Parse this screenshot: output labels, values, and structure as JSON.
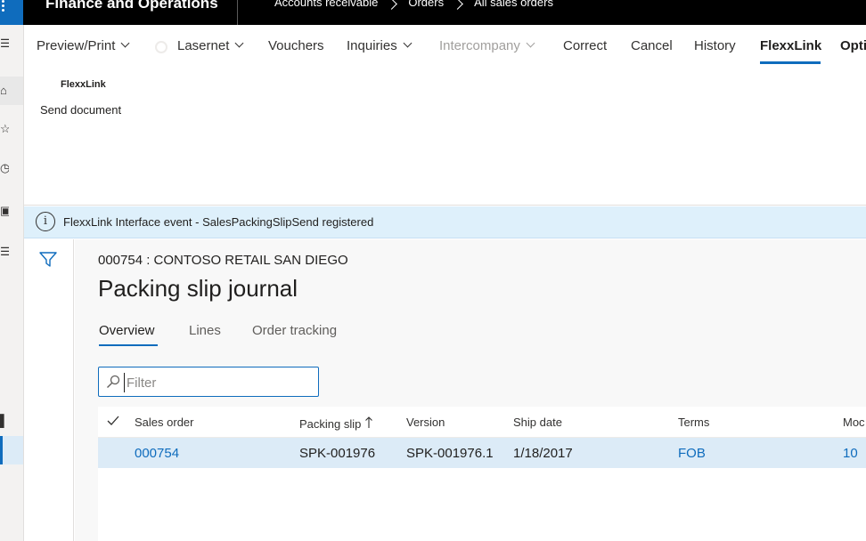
{
  "topbar": {
    "app_title": "Finance and Operations",
    "breadcrumb": [
      "Accounts receivable",
      "Orders",
      "All sales orders"
    ]
  },
  "actions": {
    "preview_print": "Preview/Print",
    "lasernet": "Lasernet",
    "vouchers": "Vouchers",
    "inquiries": "Inquiries",
    "intercompany": "Intercompany",
    "correct": "Correct",
    "cancel": "Cancel",
    "history": "History",
    "flexxlink": "FlexxLink",
    "options": "Opti"
  },
  "ribbon": {
    "group_label": "FlexxLink",
    "send_document": "Send document"
  },
  "info_bar": {
    "message": "FlexxLink Interface event - SalesPackingSlipSend registered"
  },
  "page": {
    "record_title": "000754 : CONTOSO RETAIL SAN DIEGO",
    "title": "Packing slip journal",
    "tabs": [
      "Overview",
      "Lines",
      "Order tracking"
    ],
    "active_tab": "Overview"
  },
  "filter": {
    "placeholder": "Filter",
    "value": ""
  },
  "grid": {
    "columns": [
      "Sales order",
      "Packing slip",
      "Version",
      "Ship date",
      "Terms",
      "Moc"
    ],
    "sorted_column": "Packing slip",
    "sort_direction": "ascending",
    "rows": [
      {
        "sales_order": "000754",
        "packing_slip": "SPK-001976",
        "version": "SPK-001976.1",
        "ship_date": "1/18/2017",
        "terms": "FOB",
        "mode": "10"
      }
    ]
  },
  "colors": {
    "accent": "#0f6cbd",
    "topbar": "#000000",
    "info_bar": "#def0fb",
    "selected_row": "#dcebf7"
  },
  "icons": {
    "waffle": "waffle-icon",
    "info": "info-icon",
    "filter_pane": "filter-funnel-icon",
    "search": "search-icon",
    "sort": "sort-up-arrow-icon",
    "select_all": "checkmark-icon"
  }
}
